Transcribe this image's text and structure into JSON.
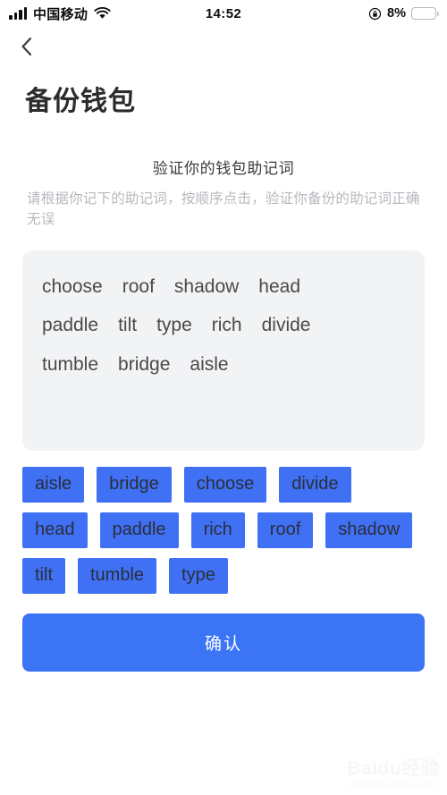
{
  "status_bar": {
    "carrier": "中国移动",
    "time": "14:52",
    "battery_percent": "8%",
    "battery_level": 8,
    "battery_color": "#f4301f",
    "signal_icon": "signal-bars-icon",
    "wifi_icon": "wifi-icon",
    "rotation_lock_icon": "rotation-lock-icon"
  },
  "nav": {
    "back_icon": "chevron-left-icon"
  },
  "page": {
    "title": "备份钱包"
  },
  "verify": {
    "heading": "验证你的钱包助记词",
    "subtext": "请根据你记下的助记词，按顺序点击，验证你备份的助记词正确无误"
  },
  "mnemonic_panel": {
    "background": "#f2f3f5",
    "rows": [
      [
        "choose",
        "roof",
        "shadow",
        "head"
      ],
      [
        "paddle",
        "tilt",
        "type",
        "rich",
        "divide"
      ],
      [
        "tumble",
        "bridge",
        "aisle"
      ]
    ]
  },
  "word_bank": {
    "chip_color": "#4070f4",
    "chips": [
      "aisle",
      "bridge",
      "choose",
      "divide",
      "head",
      "paddle",
      "rich",
      "roof",
      "shadow",
      "tilt",
      "tumble",
      "type"
    ]
  },
  "confirm": {
    "label": "确认",
    "color": "#3b74f5"
  },
  "watermark": {
    "main": "Baidu经验",
    "sub": "jingyan.baidu.com"
  }
}
